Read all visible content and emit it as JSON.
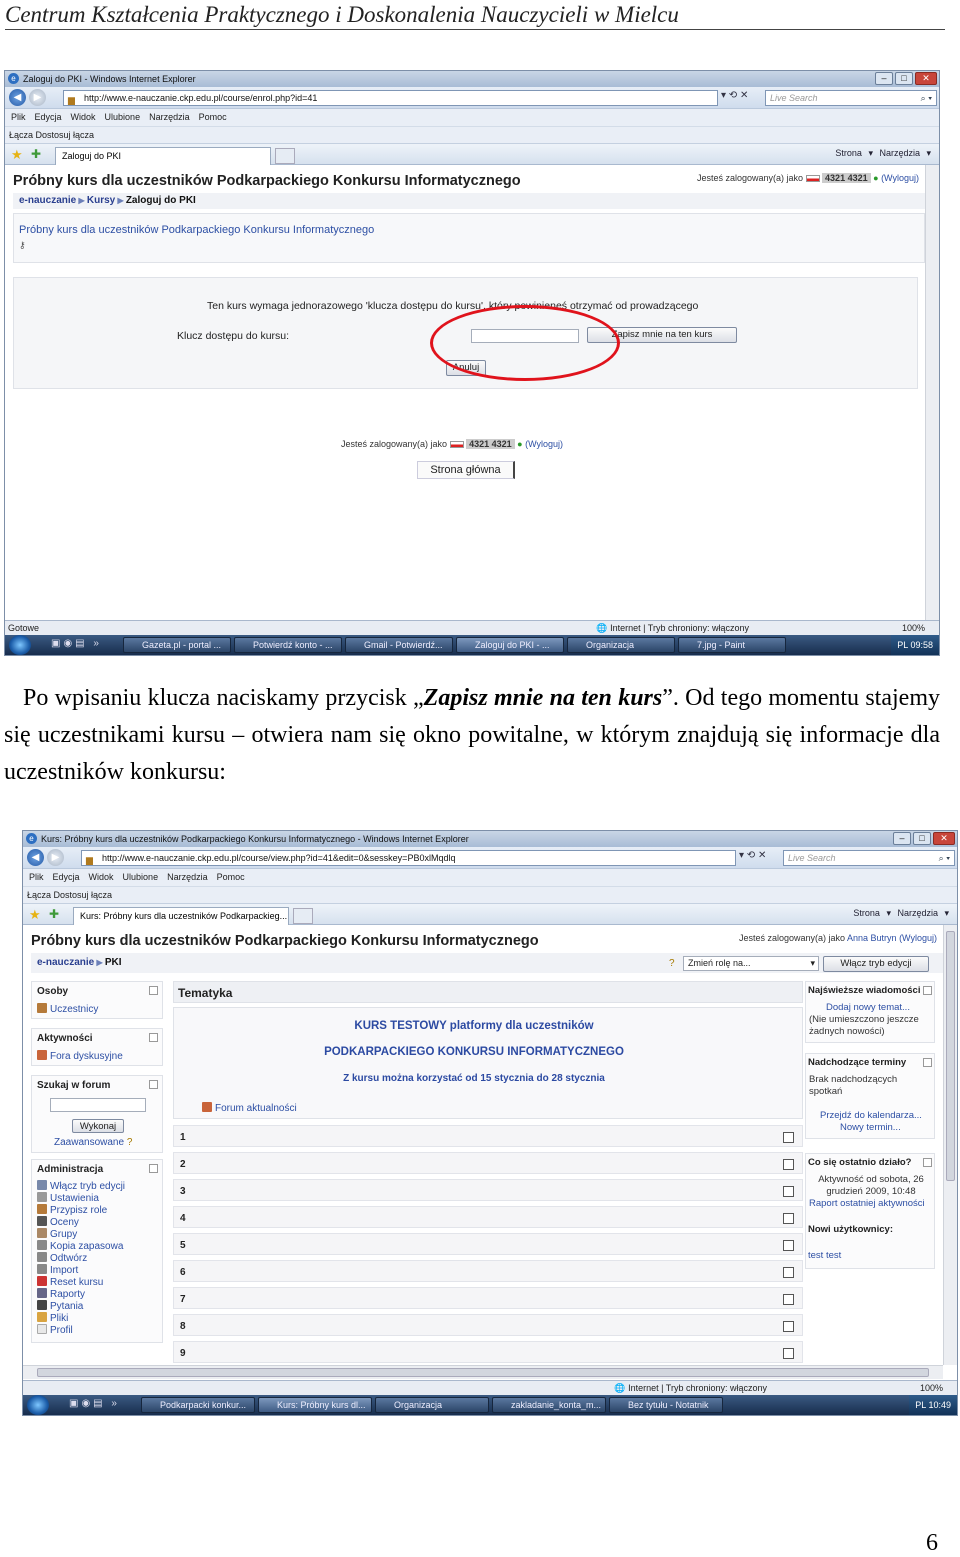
{
  "document": {
    "header": "Centrum Kształcenia Praktycznego i Doskonalenia Nauczycieli w Mielcu",
    "paragraph_before": "Po wpisaniu klucza naciskamy przycisk „",
    "paragraph_emph": "Zapisz mnie na ten kurs",
    "paragraph_after": "”. Od tego momentu stajemy się uczestnikami kursu – otwiera nam się okno powitalne, w którym znajdują się informacje dla uczestników konkursu:",
    "page_number": "6"
  },
  "shot1": {
    "window_title": "Zaloguj do PKI - Windows Internet Explorer",
    "url": "http://www.e-nauczanie.ckp.edu.pl/course/enrol.php?id=41",
    "search_placeholder": "Live Search",
    "menu": [
      "Plik",
      "Edycja",
      "Widok",
      "Ulubione",
      "Narzędzia",
      "Pomoc"
    ],
    "links_bar": "Łącza    Dostosuj łącza",
    "tab_title": "Zaloguj do PKI",
    "tools": "Strona ▾   Narzędzia ▾",
    "page_title": "Próbny kurs dla uczestników Podkarpackiego Konkursu Informatycznego",
    "logged_prefix": "Jesteś zalogowany(a) jako",
    "logged_user": "4321 4321",
    "logout": "(Wyloguj)",
    "breadcrumb": [
      "e-nauczanie",
      "Kursy",
      "Zaloguj do PKI"
    ],
    "course_link": "Próbny kurs dla uczestników Podkarpackiego Konkursu Informatycznego",
    "enrol_message": "Ten kurs wymaga jednorazowego 'klucza dostępu do kursu', który powinieneś otrzymać od prowadzącego",
    "key_label": "Klucz dostępu do kursu:",
    "enrol_button": "Zapisz mnie na ten kurs",
    "cancel_button": "Anuluj",
    "footer_logged_prefix": "Jesteś zalogowany(a) jako",
    "footer_user": "4321 4321",
    "footer_logout": "(Wyloguj)",
    "home_link": "Strona główna",
    "status_left": "Gotowe",
    "status_zone": "Internet | Tryb chroniony: włączony",
    "status_zoom": "100%",
    "taskbar": [
      "Gazeta.pl - portal ...",
      "Potwierdź konto - ...",
      "Gmail - Potwierdź...",
      "Zaloguj do PKI - ...",
      "Organizacja",
      "7.jpg - Paint"
    ],
    "clock": "PL   09:58"
  },
  "shot2": {
    "window_title": "Kurs: Próbny kurs dla uczestników Podkarpackiego Konkursu Informatycznego - Windows Internet Explorer",
    "url": "http://www.e-nauczanie.ckp.edu.pl/course/view.php?id=41&edit=0&sesskey=PB0xlMqdlq",
    "search_placeholder": "Live Search",
    "menu": [
      "Plik",
      "Edycja",
      "Widok",
      "Ulubione",
      "Narzędzia",
      "Pomoc"
    ],
    "links_bar": "Łącza    Dostosuj łącza",
    "tab_title": "Kurs: Próbny kurs dla uczestników Podkarpackieg...",
    "tools": "Strona ▾   Narzędzia ▾",
    "page_title": "Próbny kurs dla uczestników Podkarpackiego Konkursu Informatycznego",
    "logged_prefix": "Jesteś zalogowany(a) jako",
    "logged_user": "Anna Butryn",
    "logout": "(Wyloguj)",
    "breadcrumb": [
      "e-nauczanie",
      "PKI"
    ],
    "role_select": "Zmień rolę na...",
    "edit_button": "Włącz tryb edycji",
    "people": {
      "title": "Osoby",
      "items": [
        "Uczestnicy"
      ]
    },
    "activities": {
      "title": "Aktywności",
      "items": [
        "Fora dyskusyjne"
      ]
    },
    "forum_search": {
      "title": "Szukaj w forum",
      "button": "Wykonaj",
      "advanced": "Zaawansowane"
    },
    "admin": {
      "title": "Administracja",
      "items": [
        "Włącz tryb edycji",
        "Ustawienia",
        "Przypisz role",
        "Oceny",
        "Grupy",
        "Kopia zapasowa",
        "Odtwórz",
        "Import",
        "Reset kursu",
        "Raporty",
        "Pytania",
        "Pliki",
        "Profil"
      ]
    },
    "topics_title": "Tematyka",
    "topics_intro": [
      "KURS TESTOWY platformy dla uczestników",
      "PODKARPACKIEGO KONKURSU INFORMATYCZNEGO",
      "Z kursu można korzystać od 15 stycznia do 28 stycznia"
    ],
    "news_forum": "Forum aktualności",
    "sections": [
      "1",
      "2",
      "3",
      "4",
      "5",
      "6",
      "7",
      "8",
      "9"
    ],
    "news": {
      "title": "Najświeższe wiadomości",
      "add": "Dodaj nowy temat...",
      "empty": "(Nie umieszczono jeszcze żadnych nowości)"
    },
    "events": {
      "title": "Nadchodzące terminy",
      "none": "Brak nadchodzących spotkań",
      "calendar": "Przejdź do kalendarza...",
      "new": "Nowy termin..."
    },
    "recent": {
      "title": "Co się ostatnio działo?",
      "since": "Aktywność od sobota, 26 grudzień 2009, 10:48",
      "report": "Raport ostatniej aktywności",
      "new_users": "Nowi użytkownicy:",
      "user": "test test"
    },
    "status_zone": "Internet | Tryb chroniony: włączony",
    "status_zoom": "100%",
    "taskbar": [
      "Podkarpacki konkur...",
      "Kurs: Próbny kurs dl...",
      "Organizacja",
      "zakladanie_konta_m...",
      "Bez tytułu - Notatnik"
    ],
    "clock": "PL   10:49"
  }
}
